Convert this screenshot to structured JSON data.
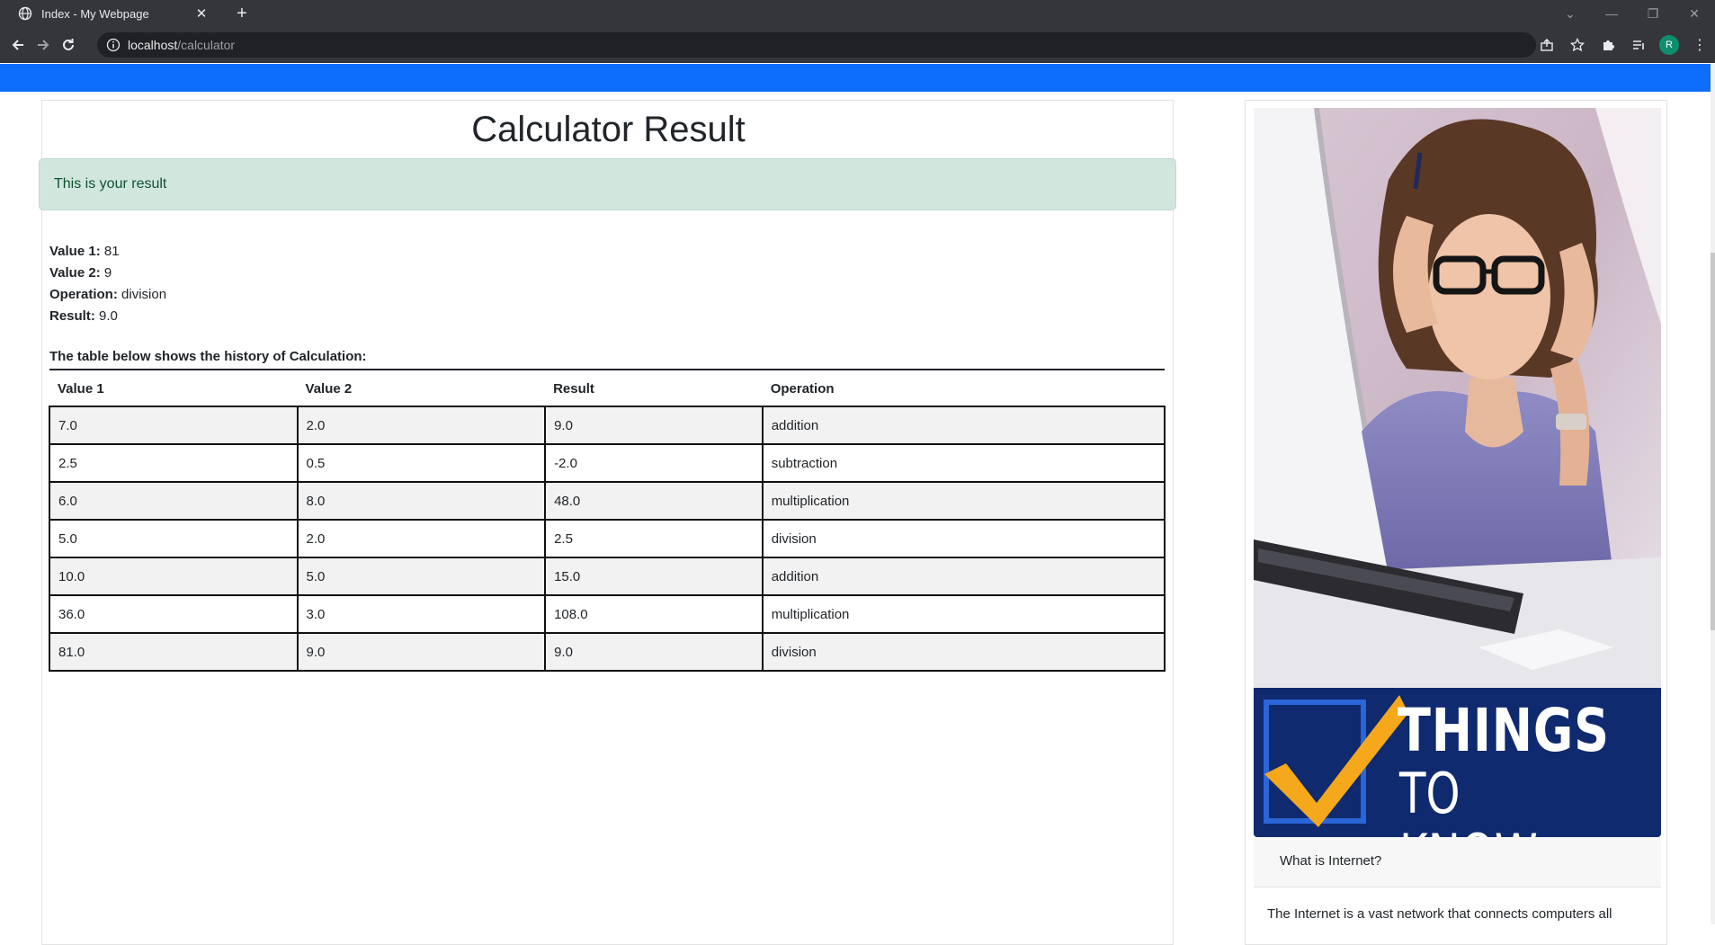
{
  "browser": {
    "tab_title": "Index - My Webpage",
    "url_host": "localhost",
    "url_path": "/calculator",
    "profile_initial": "R"
  },
  "page": {
    "title": "Calculator Result",
    "alert_text": "This is your result",
    "summary": {
      "value1_label": "Value 1:",
      "value1": "81",
      "value2_label": "Value 2:",
      "value2": "9",
      "operation_label": "Operation:",
      "operation": "division",
      "result_label": "Result:",
      "result": "9.0"
    },
    "history_caption": "The table below shows the history of Calculation:",
    "history_headers": [
      "Value 1",
      "Value 2",
      "Result",
      "Operation"
    ],
    "history_rows": [
      [
        "7.0",
        "2.0",
        "9.0",
        "addition"
      ],
      [
        "2.5",
        "0.5",
        "-2.0",
        "subtraction"
      ],
      [
        "6.0",
        "8.0",
        "48.0",
        "multiplication"
      ],
      [
        "5.0",
        "2.0",
        "2.5",
        "division"
      ],
      [
        "10.0",
        "5.0",
        "15.0",
        "addition"
      ],
      [
        "36.0",
        "3.0",
        "108.0",
        "multiplication"
      ],
      [
        "81.0",
        "9.0",
        "9.0",
        "division"
      ]
    ]
  },
  "sidebar": {
    "banner_line1": "THINGS",
    "banner_line2": "TO KNOW",
    "card_header": "What is Internet?",
    "card_text": "The Internet is a vast network that connects computers all"
  },
  "colors": {
    "navbar": "#0d6efd",
    "alert_bg": "#d1e7dd",
    "alert_text": "#0f5132",
    "banner_bg": "#0f2a6e",
    "check_yellow": "#f5a81c"
  }
}
